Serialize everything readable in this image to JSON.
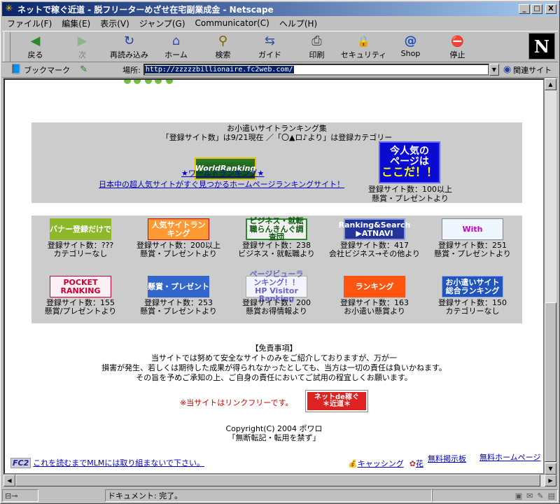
{
  "window": {
    "title": "ネットで稼ぐ近道 - 脱フリーターめざせ在宅副業成金 - Netscape",
    "min_glyph": "_",
    "max_glyph": "□",
    "close_glyph": "X"
  },
  "menu": {
    "items": [
      "ファイル(F)",
      "編集(E)",
      "表示(V)",
      "ジャンプ(G)",
      "Communicator(C)",
      "ヘルプ(H)"
    ]
  },
  "toolbar": {
    "buttons": [
      {
        "label": "戻る",
        "icon": "back-arrow-icon",
        "glyph": "◀",
        "enabled": true
      },
      {
        "label": "次",
        "icon": "forward-arrow-icon",
        "glyph": "▶",
        "enabled": false
      },
      {
        "label": "再読み込み",
        "icon": "reload-icon",
        "glyph": "↻",
        "enabled": true
      },
      {
        "label": "ホーム",
        "icon": "home-icon",
        "glyph": "⌂",
        "enabled": true
      },
      {
        "label": "検索",
        "icon": "search-icon",
        "glyph": "⚲",
        "enabled": true
      },
      {
        "label": "ガイド",
        "icon": "guide-icon",
        "glyph": "⇆",
        "enabled": true
      },
      {
        "label": "印刷",
        "icon": "print-icon",
        "glyph": "⎙",
        "enabled": true
      },
      {
        "label": "セキュリティ",
        "icon": "lock-icon",
        "glyph": "🔒",
        "enabled": true
      },
      {
        "label": "Shop",
        "icon": "shop-icon",
        "glyph": "@",
        "enabled": true
      },
      {
        "label": "停止",
        "icon": "stop-icon",
        "glyph": "⛔",
        "enabled": true
      }
    ],
    "logo": "N"
  },
  "location": {
    "bookmarks_label": "ブックマーク",
    "location_label": "場所:",
    "url": "http://zzzzzbillionaire.fc2web.com/",
    "related_label": "関連サイト"
  },
  "ranking_intro": {
    "heading": "お小遣いサイトランキング集",
    "note": "「登録サイト数」は9/21現在 ／「〇▲ロ♪より」は登録カテゴリー",
    "worldranking_banner": "WorldRanking",
    "worldranking_link": "★ワールドランキング★",
    "worldranking_sub": "日本中の超人気サイトがすぐ見つかるホームページランキングサイト！",
    "popular_banner_line1": "今人気の",
    "popular_banner_line2": "ページは",
    "popular_banner_line3": "ここだ！！",
    "popular_count": "登録サイト数：100以上",
    "popular_cat": "懸賞・プレゼントより"
  },
  "ranking_grid": [
    {
      "banner": "バナー登録だけで",
      "count": "登録サイト数：???",
      "cat": "カテゴリーなし"
    },
    {
      "banner": "人気サイトランキング",
      "count": "登録サイト数：200以上",
      "cat": "懸賞・プレゼントより"
    },
    {
      "banner": "ビジネス・就転職らんきんぐ調査団",
      "count": "登録サイト数：238",
      "cat": "ビジネス・就転職より"
    },
    {
      "banner": "Ranking&Search ▶ATNAVI",
      "count": "登録サイト数：417",
      "cat": "会社ビジネス→その他より"
    },
    {
      "banner": "With",
      "count": "登録サイト数：251",
      "cat": "懸賞・プレゼントより"
    },
    {
      "banner": "POCKET RANKING",
      "count": "登録サイト数：155",
      "cat": "懸賞/プレゼントより"
    },
    {
      "banner": "懸賞・プレゼント",
      "count": "登録サイト数：253",
      "cat": "懸賞・プレゼントより"
    },
    {
      "banner": "ページビューランキング！！ HP Visitor Ranking",
      "count": "登録サイト数：200",
      "cat": "懸賞お得情報より"
    },
    {
      "banner": "ランキング",
      "count": "登録サイト数：163",
      "cat": "お小遣い懸賞より"
    },
    {
      "banner": "お小遣いサイト総合ランキング",
      "count": "登録サイト数：150",
      "cat": "カテゴリーなし"
    }
  ],
  "disclaimer": {
    "title": "【免責事項】",
    "line1": "当サイトでは努めて安全なサイトのみをご紹介しておりますが、万が一",
    "line2": "損害が発生、若しくは期待した成果が得られなかったとしても、当方は一切の責任は負いかねます。",
    "line3": "その旨を予めご承知の上、ご自身の責任においてご試用の程宜しくお願います。"
  },
  "linkfree": {
    "text": "※当サイトはリンクフリーです。",
    "banner_line1": "ネットde稼ぐ",
    "banner_line2": "＊近道＊"
  },
  "copyright": {
    "line1": "Copyright(C) 2004 ポワロ",
    "line2": "「無断転記・転用を禁ず」"
  },
  "footer": {
    "fc2_logo": "FC2",
    "left_link": "これを読むまでMLMには取り組まないで下さい。",
    "caching": "キャッシング",
    "flower": "花",
    "board": "無料掲示板",
    "homepage": "無料ホームページ"
  },
  "status": {
    "message": "ドキュメント: 完了。"
  }
}
